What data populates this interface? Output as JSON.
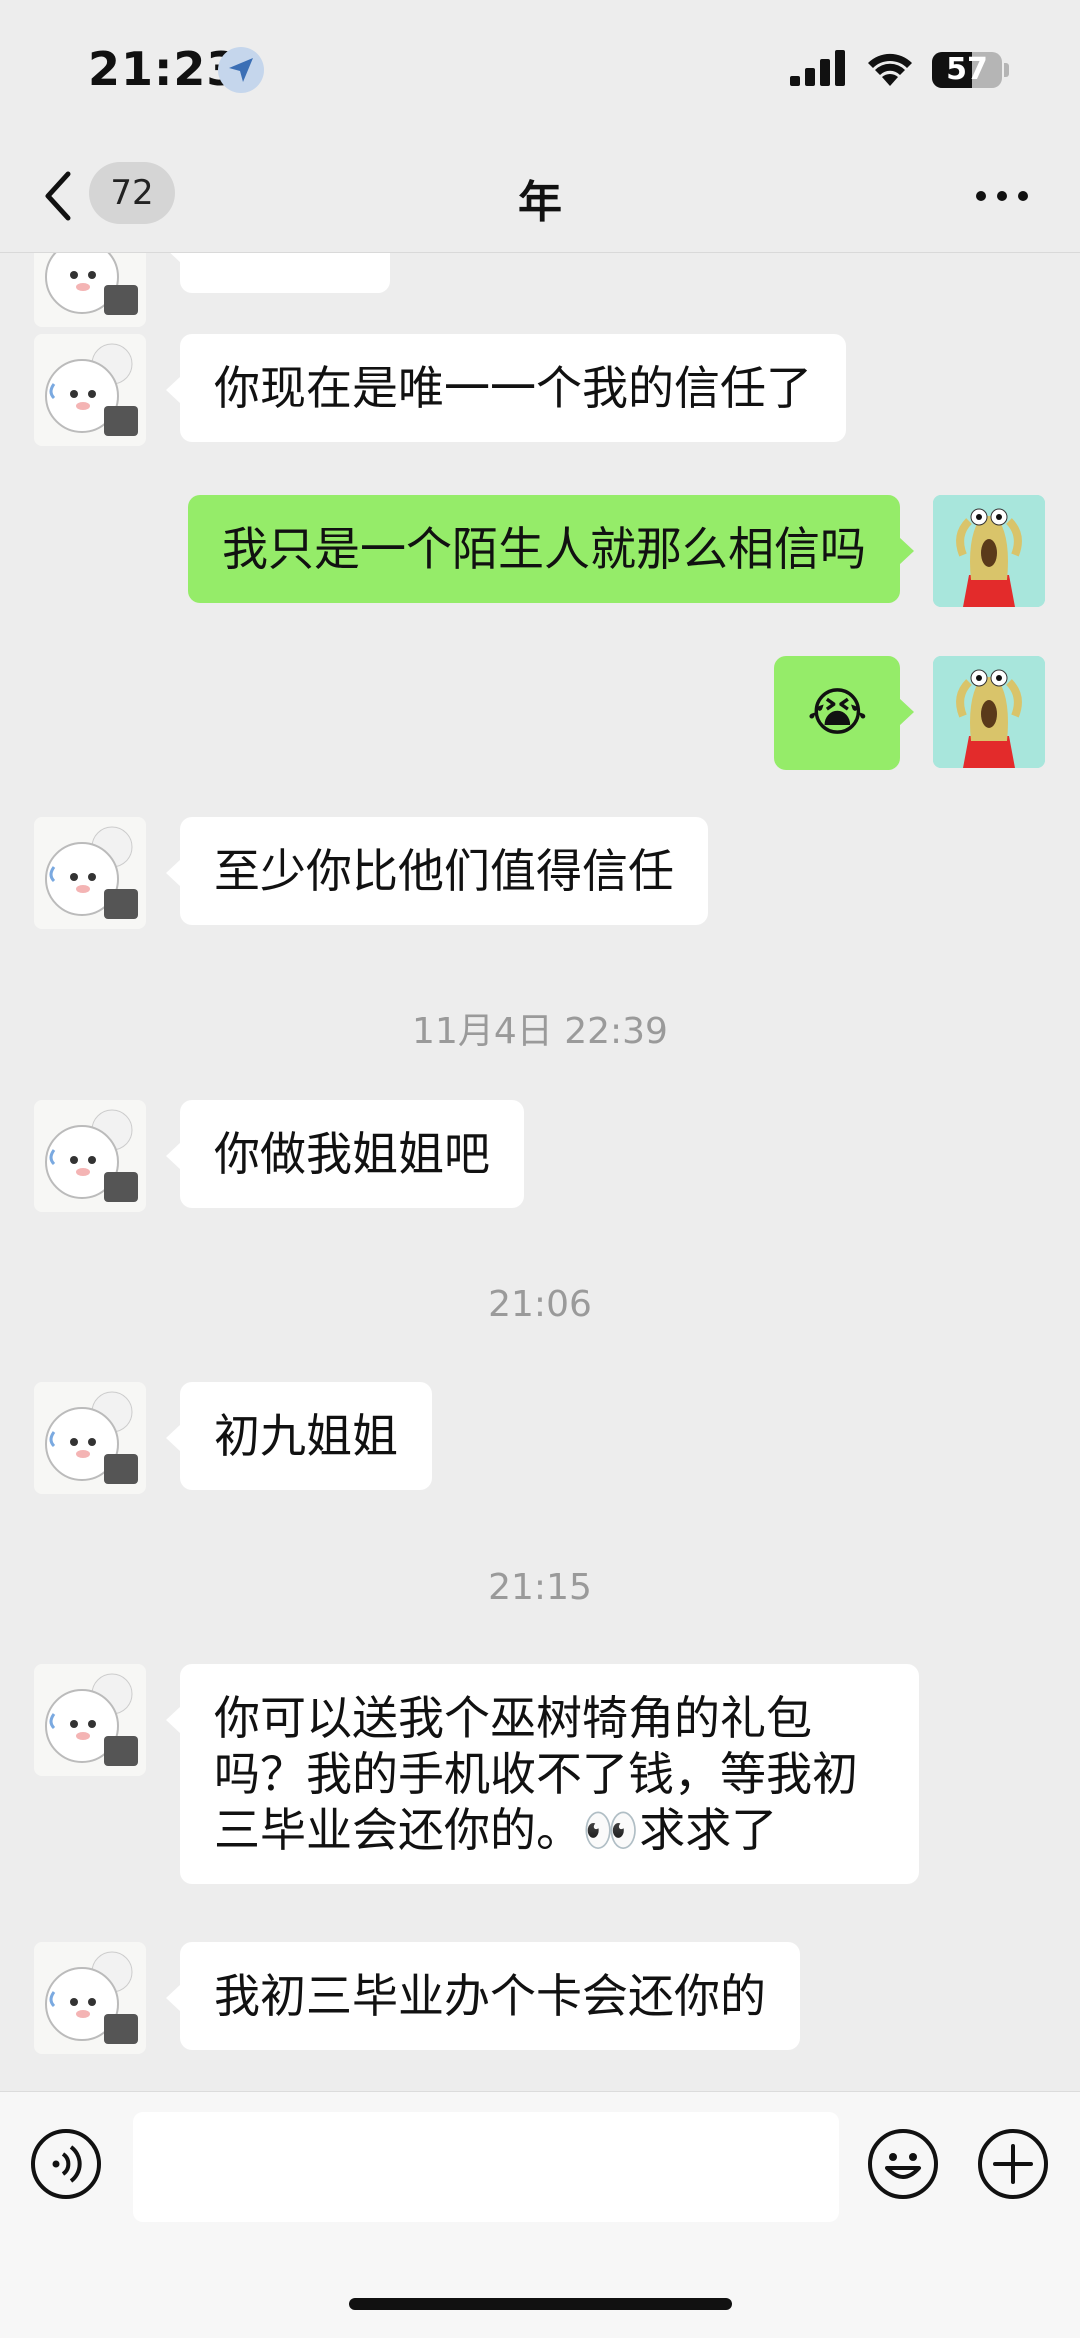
{
  "status_bar": {
    "time": "21:23",
    "battery": "57",
    "battery_level": 0.57,
    "icons": [
      "location-arrow-icon",
      "cellular-signal-icon",
      "wifi-icon",
      "battery-icon"
    ]
  },
  "nav": {
    "back_icon": "chevron-left-icon",
    "unread_count": "72",
    "title": "年",
    "more_icon": "more-dots-icon"
  },
  "messages": [
    {
      "side": "left",
      "text": "你现在是唯一一个我的信任了"
    },
    {
      "side": "right",
      "text": "我只是一个陌生人就那么相信吗"
    },
    {
      "side": "right",
      "text": "😭",
      "emoji": "crying-laughing-emoji"
    },
    {
      "side": "left",
      "text": "至少你比他们值得信任"
    },
    {
      "timestamp": "11月4日 22:39"
    },
    {
      "side": "left",
      "text": "你做我姐姐吧"
    },
    {
      "timestamp": "21:06"
    },
    {
      "side": "left",
      "text": "初九姐姐"
    },
    {
      "timestamp": "21:15"
    },
    {
      "side": "left",
      "lines": [
        "你可以送我个巫树犄角的礼包",
        "吗？我的手机收不了钱，等我初",
        "三毕业会还你的。👀求求了"
      ]
    },
    {
      "side": "left",
      "text": "我初三毕业办个卡会还你的"
    }
  ],
  "input_bar": {
    "icons": [
      "voice-icon",
      "emoji-icon",
      "plus-icon"
    ],
    "placeholder": ""
  },
  "colors": {
    "background": "#ededed",
    "outgoing_bubble": "#95ec69",
    "incoming_bubble": "#ffffff",
    "timestamp_text": "#9a9a9a"
  }
}
